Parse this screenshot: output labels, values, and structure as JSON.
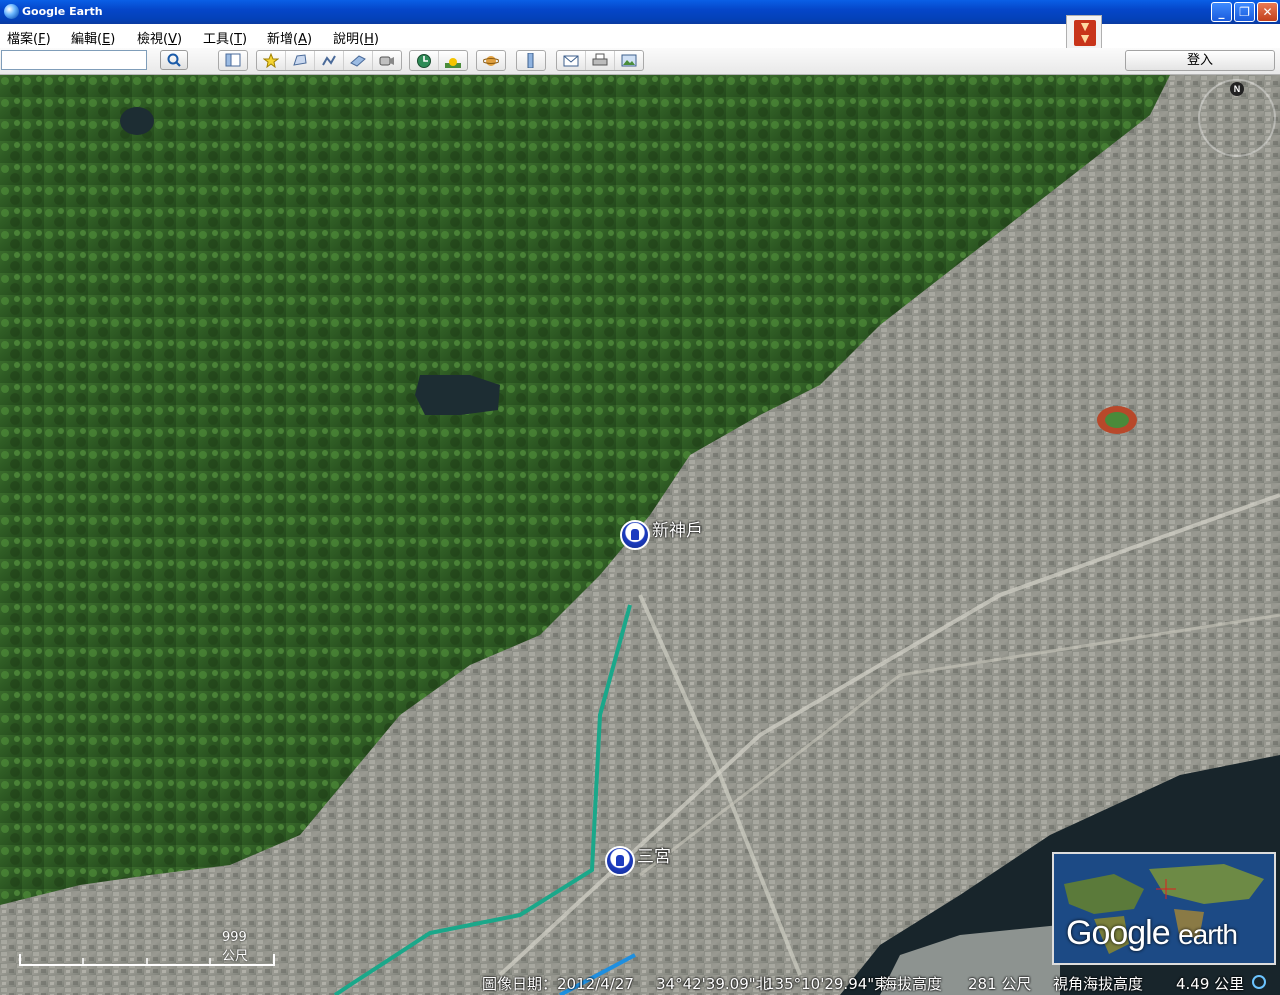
{
  "window": {
    "title": "Google Earth",
    "minimize": "_",
    "maximize": "❐",
    "close": "✕"
  },
  "menu": {
    "items": [
      {
        "label": "檔案(",
        "key": "F",
        "end": ")"
      },
      {
        "label": "編輯(",
        "key": "E",
        "end": ")"
      },
      {
        "label": "檢視(",
        "key": "V",
        "end": ")"
      },
      {
        "label": "工具(",
        "key": "T",
        "end": ")"
      },
      {
        "label": "新增(",
        "key": "A",
        "end": ")"
      },
      {
        "label": "說明(",
        "key": "H",
        "end": ")"
      }
    ]
  },
  "toolbar": {
    "search_value": "",
    "login_label": "登入",
    "tools": [
      "sidebar-toggle-icon",
      "placemark-icon",
      "polygon-icon",
      "path-icon",
      "image-overlay-icon",
      "record-tour-icon",
      "historical-imagery-icon",
      "sunlight-icon",
      "planet-icon",
      "ruler-icon",
      "email-icon",
      "print-icon",
      "save-image-icon"
    ]
  },
  "map": {
    "stations": [
      {
        "name": "新神戶"
      },
      {
        "name": "三宮"
      }
    ],
    "compass_north": "N",
    "scale_label": "999 公尺",
    "overview_logo_main": "Google",
    "overview_logo_small": "earth"
  },
  "status": {
    "imagery_date": "圖像日期：2012/4/27",
    "latitude": "34°42'39.09\"北",
    "longitude": "135°10'29.94\"東",
    "elevation_label": "海拔高度",
    "elevation_value": "281 公尺",
    "eye_alt_label": "視角海拔高度",
    "eye_alt_value": "4.49 公里"
  },
  "colors": {
    "titlebar": "#0546c9",
    "route_primary": "#1aa88a",
    "route_secondary": "#1e8fe0",
    "station_pin": "#1c3bbf"
  }
}
